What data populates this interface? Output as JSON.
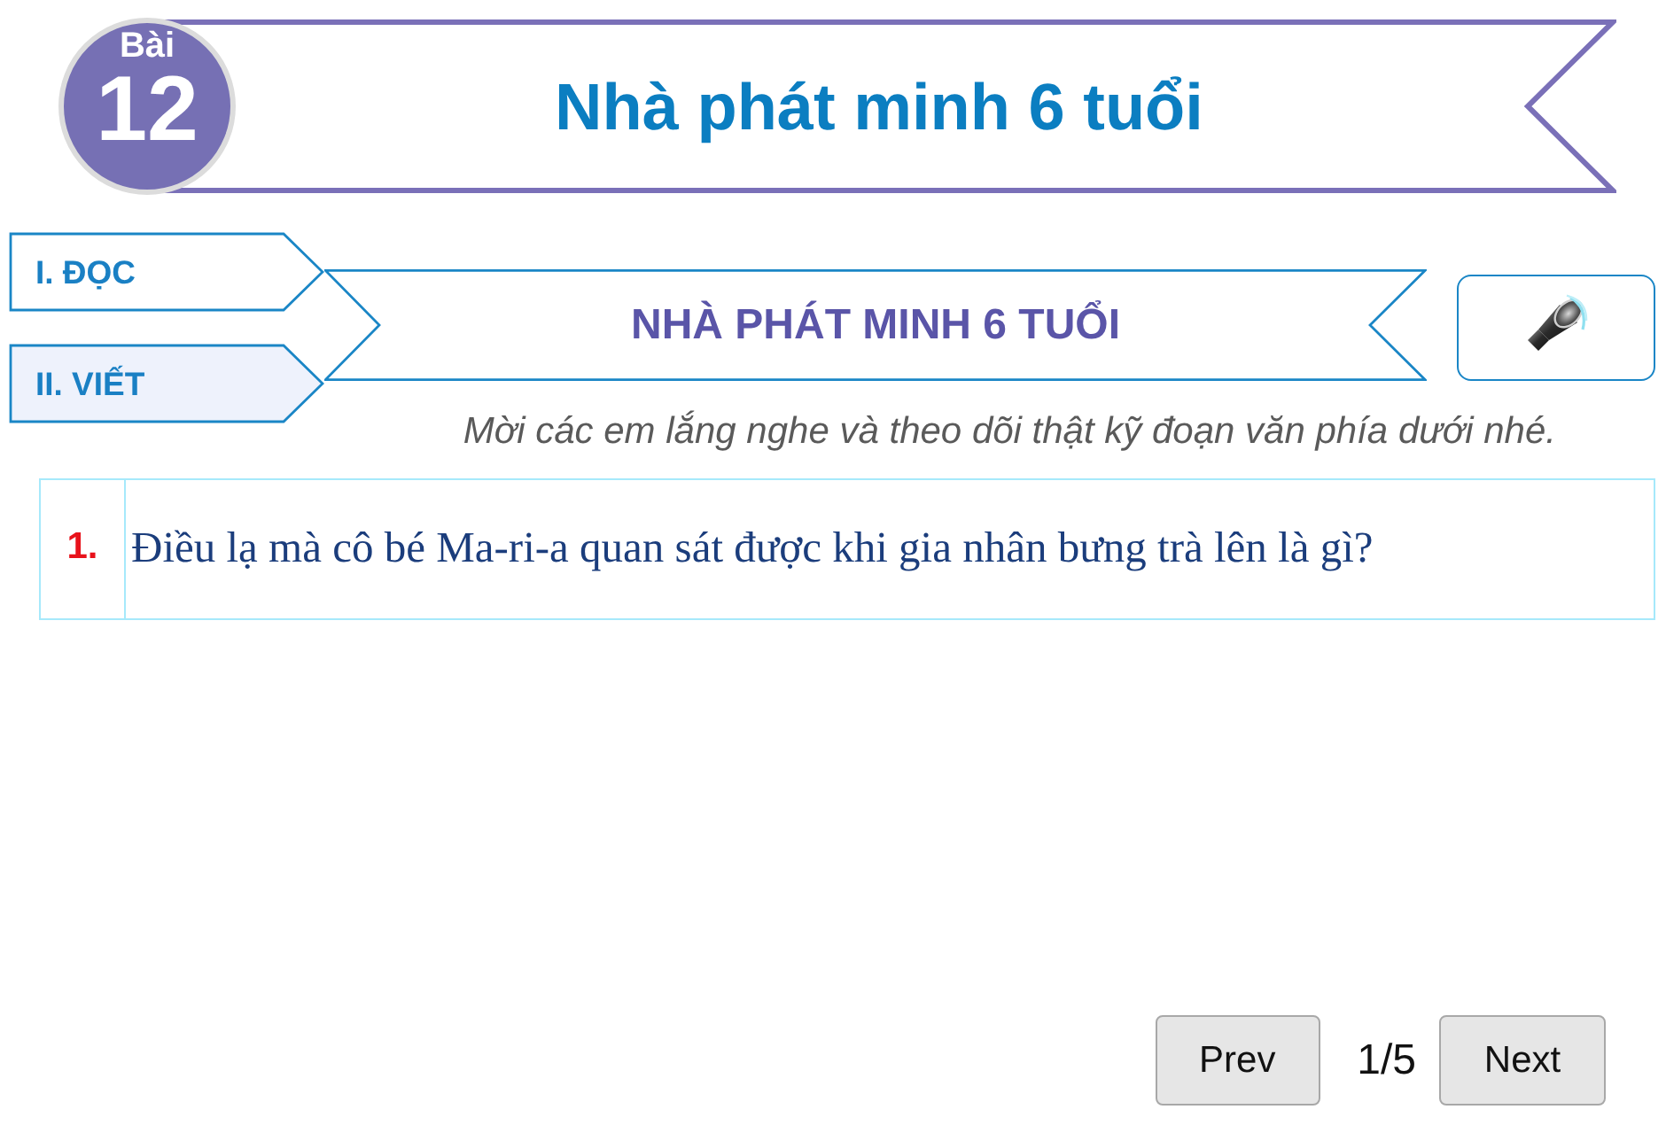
{
  "lesson_badge": {
    "label": "Bài",
    "number": "12"
  },
  "lesson_title": "Nhà phát minh 6 tuổi",
  "tabs": [
    {
      "label": "I. ĐỌC",
      "selected": false
    },
    {
      "label": "II. VIẾT",
      "selected": true
    }
  ],
  "section_title": "NHÀ PHÁT MINH 6 TUỔI",
  "instruction": "Mời các em lắng nghe và theo dõi thật kỹ đoạn văn phía dưới nhé.",
  "question": {
    "number": "1.",
    "text": "Điều lạ mà cô bé Ma-ri-a quan sát được khi gia nhân bưng trà lên là gì?"
  },
  "pagination": {
    "prev": "Prev",
    "counter": "1/5",
    "next": "Next"
  }
}
